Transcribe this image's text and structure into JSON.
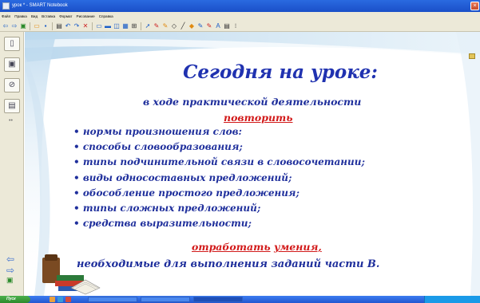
{
  "window": {
    "title": "урок * - SMART Notebook"
  },
  "menu": [
    "Файл",
    "Правка",
    "Вид",
    "Вставка",
    "Формат",
    "Рисование",
    "Справка"
  ],
  "toolbar": {
    "icons": [
      "back-icon",
      "forward-icon",
      "add-page-icon",
      "open-icon",
      "save-icon",
      "paste-icon",
      "undo-icon",
      "redo-icon",
      "delete-icon",
      "screen-shade-icon",
      "full-screen-icon",
      "dual-page-icon",
      "capture-icon",
      "table-icon",
      "select-icon",
      "pen-icon",
      "creative-pen-icon",
      "eraser-icon",
      "line-icon",
      "shape-icon",
      "fill-icon",
      "magic-pen-icon",
      "text-icon",
      "properties-icon",
      "more-icon"
    ]
  },
  "sidebar": {
    "tabs": [
      "page-sorter-icon",
      "gallery-icon",
      "attachments-icon",
      "properties-icon"
    ]
  },
  "slide": {
    "title": "Сегодня на  уроке:",
    "subtitle": "в ходе практической деятельности",
    "repeat_word": "повторить",
    "bullets": [
      "нормы произношения слов:",
      "способы словообразования;",
      "типы подчинительной связи в словосочетании;",
      "виды односоставных предложений;",
      "обособление простого предложения;",
      "типы сложных предложений;",
      "средства  выразительности;"
    ],
    "train_word_1": "отработать",
    "train_word_2": "умения,",
    "final_line": "необходимые для выполнения заданий части В."
  },
  "taskbar": {
    "start_label": "Пуск"
  },
  "colors": {
    "title_blue": "#2032b0",
    "text_blue": "#1f2f9c",
    "accent_red": "#d21a1a",
    "chrome": "#ece9d8",
    "titlebar_blue": "#1a4fc8"
  }
}
